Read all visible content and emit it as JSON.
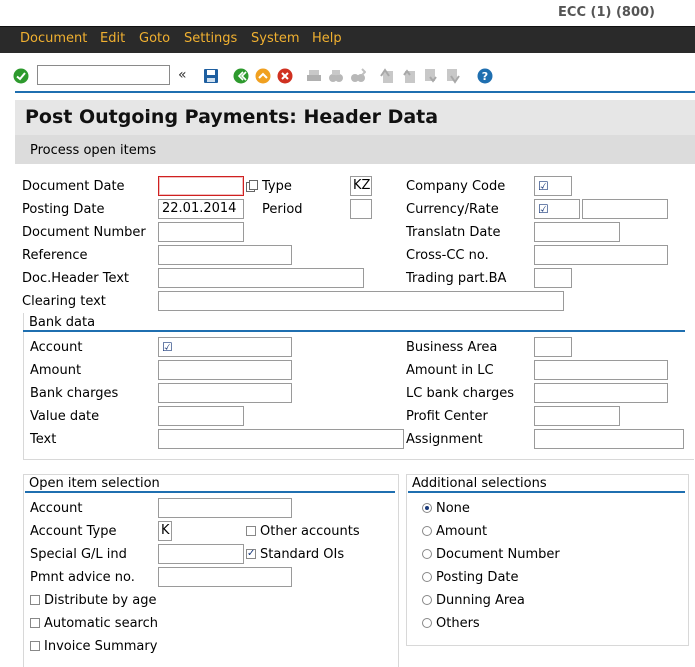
{
  "window": {
    "system": "ECC (1) (800)"
  },
  "menu": [
    "Document",
    "Edit",
    "Goto",
    "Settings",
    "System",
    "Help"
  ],
  "toolbar": {
    "command_value": ""
  },
  "page": {
    "title": "Post Outgoing Payments: Header Data",
    "action": "Process open items"
  },
  "header_fields": {
    "document_date": {
      "label": "Document Date",
      "value": ""
    },
    "type": {
      "label": "Type",
      "value": "KZ"
    },
    "company_code": {
      "label": "Company Code",
      "value": ""
    },
    "posting_date": {
      "label": "Posting Date",
      "value": "22.01.2014"
    },
    "period": {
      "label": "Period",
      "value": ""
    },
    "currency_rate": {
      "label": "Currency/Rate",
      "value": "",
      "rate": ""
    },
    "document_number": {
      "label": "Document Number",
      "value": ""
    },
    "translatn_date": {
      "label": "Translatn Date",
      "value": ""
    },
    "reference": {
      "label": "Reference",
      "value": ""
    },
    "cross_cc_no": {
      "label": "Cross-CC no.",
      "value": ""
    },
    "doc_header_text": {
      "label": "Doc.Header Text",
      "value": ""
    },
    "trading_part_ba": {
      "label": "Trading part.BA",
      "value": ""
    },
    "clearing_text": {
      "label": "Clearing text",
      "value": ""
    }
  },
  "bank_data": {
    "title": "Bank data",
    "account": {
      "label": "Account",
      "value": ""
    },
    "business_area": {
      "label": "Business Area",
      "value": ""
    },
    "amount": {
      "label": "Amount",
      "value": ""
    },
    "amount_in_lc": {
      "label": "Amount in LC",
      "value": ""
    },
    "bank_charges": {
      "label": "Bank charges",
      "value": ""
    },
    "lc_bank_charges": {
      "label": "LC bank charges",
      "value": ""
    },
    "value_date": {
      "label": "Value date",
      "value": ""
    },
    "profit_center": {
      "label": "Profit Center",
      "value": ""
    },
    "text": {
      "label": "Text",
      "value": ""
    },
    "assignment": {
      "label": "Assignment",
      "value": ""
    }
  },
  "open_item_selection": {
    "title": "Open item selection",
    "account": {
      "label": "Account",
      "value": ""
    },
    "account_type": {
      "label": "Account Type",
      "value": "K"
    },
    "other_accounts": {
      "label": "Other accounts",
      "checked": false
    },
    "special_gl_ind": {
      "label": "Special G/L ind",
      "value": ""
    },
    "standard_ois": {
      "label": "Standard OIs",
      "checked": true
    },
    "pmnt_advice_no": {
      "label": "Pmnt advice no.",
      "value": ""
    },
    "distribute_by_age": {
      "label": "Distribute by age",
      "checked": false
    },
    "automatic_search": {
      "label": "Automatic search",
      "checked": false
    },
    "invoice_summary": {
      "label": "Invoice Summary",
      "checked": false
    }
  },
  "additional_selections": {
    "title": "Additional selections",
    "options": [
      "None",
      "Amount",
      "Document Number",
      "Posting Date",
      "Dunning Area",
      "Others"
    ],
    "selected": "None"
  }
}
